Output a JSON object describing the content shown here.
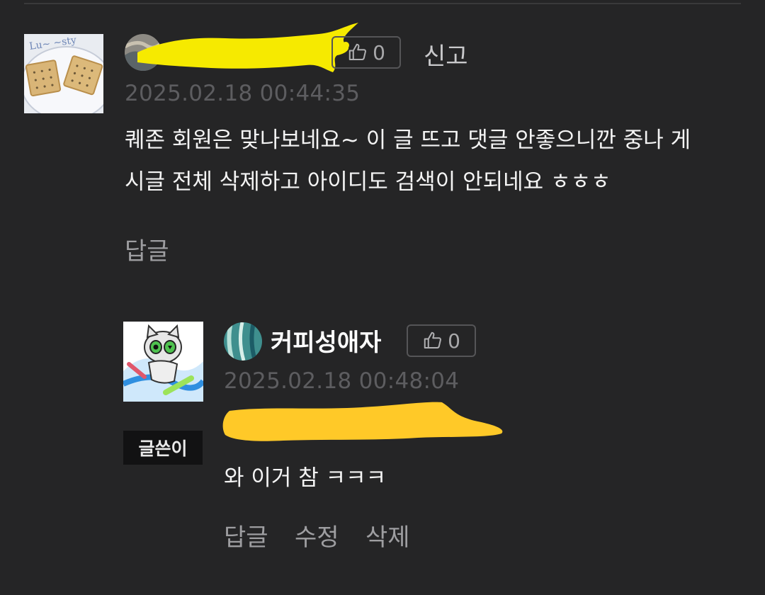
{
  "comments": [
    {
      "author": "",
      "likes": "0",
      "report_label": "신고",
      "timestamp": "2025.02.18 00:44:35",
      "text": "퀘존 회원은 맞나보네요~ 이 글 뜨고 댓글 안좋으니깐 중나 게\n시글 전체 삭제하고 아이디도 검색이 안되네요 ㅎㅎㅎ",
      "actions": {
        "reply_label": "답글"
      }
    },
    {
      "author": "커피성애자",
      "likes": "0",
      "timestamp": "2025.02.18 00:48:04",
      "badge": "글쓴이",
      "text": "와 이거 참 ㅋㅋㅋ",
      "actions": {
        "reply_label": "답글",
        "edit_label": "수정",
        "delete_label": "삭제"
      }
    }
  ],
  "icons": {
    "like": "thumbs-up-icon",
    "redaction_1_color": "#f6ea00",
    "redaction_2_color": "#ffc928"
  }
}
